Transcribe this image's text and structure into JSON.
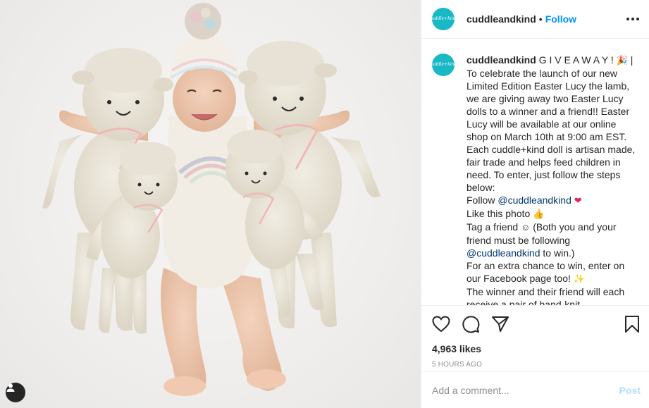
{
  "account": {
    "handle": "cuddleandkind",
    "avatar_text": "cuddle+kind",
    "follow_label": "Follow",
    "separator": "•"
  },
  "caption": {
    "handle": "cuddleandkind",
    "lines": [
      "G I V E A W A Y !",
      "To celebrate the launch of our new",
      "Limited Edition Easter Lucy the lamb,",
      "we are giving away two Easter Lucy",
      "dolls to a winner and a friend!! Easter",
      "Lucy will be available at our online",
      "shop on March 10th at 9:00 am EST.",
      "Each cuddle+kind doll is artisan made,",
      "fair trade and helps feed children in",
      "need. To enter, just follow the steps",
      "below:"
    ],
    "follow_prefix": "Follow ",
    "mention": "@cuddleandkind",
    "like_line": "Like this photo",
    "tag_line_1": "Tag a friend",
    "tag_line_1b": " (Both you and your",
    "tag_line_2": "friend must be following",
    "tag_mention": "@cuddleandkind",
    "tag_line_3": " to win.)",
    "extra_1": "For an extra chance to win, enter on",
    "extra_2": "our Facebook page too!",
    "winner_1": "The winner and their friend will each",
    "winner_2": "receive a pair of hand-knit"
  },
  "emojis": {
    "party": "🎉",
    "heart": "❤",
    "thumbs": "👍",
    "smile": "☺",
    "sparkle": "✨"
  },
  "icons": [
    "heart-icon",
    "comment-icon",
    "share-icon",
    "bookmark-icon",
    "user-tag-icon",
    "more-options-icon"
  ],
  "likes": "4,963 likes",
  "timestamp": "5 HOURS AGO",
  "comment": {
    "placeholder": "Add a comment...",
    "post_label": "Post"
  },
  "colors": {
    "accent": "#0095f6",
    "avatar": "#18b8c5",
    "post_disabled": "#b2dffc",
    "heart_emoji": "#e0245e"
  }
}
